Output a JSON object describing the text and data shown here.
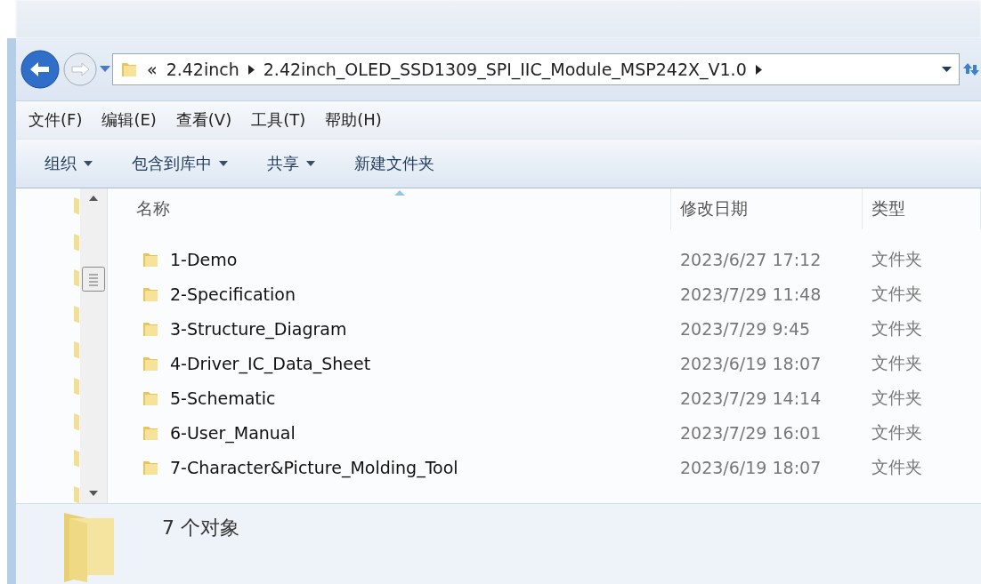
{
  "address_bar": {
    "overflow": "«",
    "crumbs": [
      "2.42inch",
      "2.42inch_OLED_SSD1309_SPI_IIC_Module_MSP242X_V1.0"
    ]
  },
  "menu": [
    "文件(F)",
    "编辑(E)",
    "查看(V)",
    "工具(T)",
    "帮助(H)"
  ],
  "toolbar": [
    {
      "label": "组织",
      "dropdown": true
    },
    {
      "label": "包含到库中",
      "dropdown": true
    },
    {
      "label": "共享",
      "dropdown": true
    },
    {
      "label": "新建文件夹",
      "dropdown": false
    }
  ],
  "table": {
    "columns": [
      "名称",
      "修改日期",
      "类型"
    ],
    "rows": [
      [
        "1-Demo",
        "2023/6/27 17:12",
        "文件夹"
      ],
      [
        "2-Specification",
        "2023/7/29 11:48",
        "文件夹"
      ],
      [
        "3-Structure_Diagram",
        "2023/7/29 9:45",
        "文件夹"
      ],
      [
        "4-Driver_IC_Data_Sheet",
        "2023/6/19 18:07",
        "文件夹"
      ],
      [
        "5-Schematic",
        "2023/7/29 14:14",
        "文件夹"
      ],
      [
        "6-User_Manual",
        "2023/7/29 16:01",
        "文件夹"
      ],
      [
        "7-Character&Picture_Molding_Tool",
        "2023/6/19 18:07",
        "文件夹"
      ]
    ]
  },
  "status_bar": {
    "count": "7 个对象"
  }
}
